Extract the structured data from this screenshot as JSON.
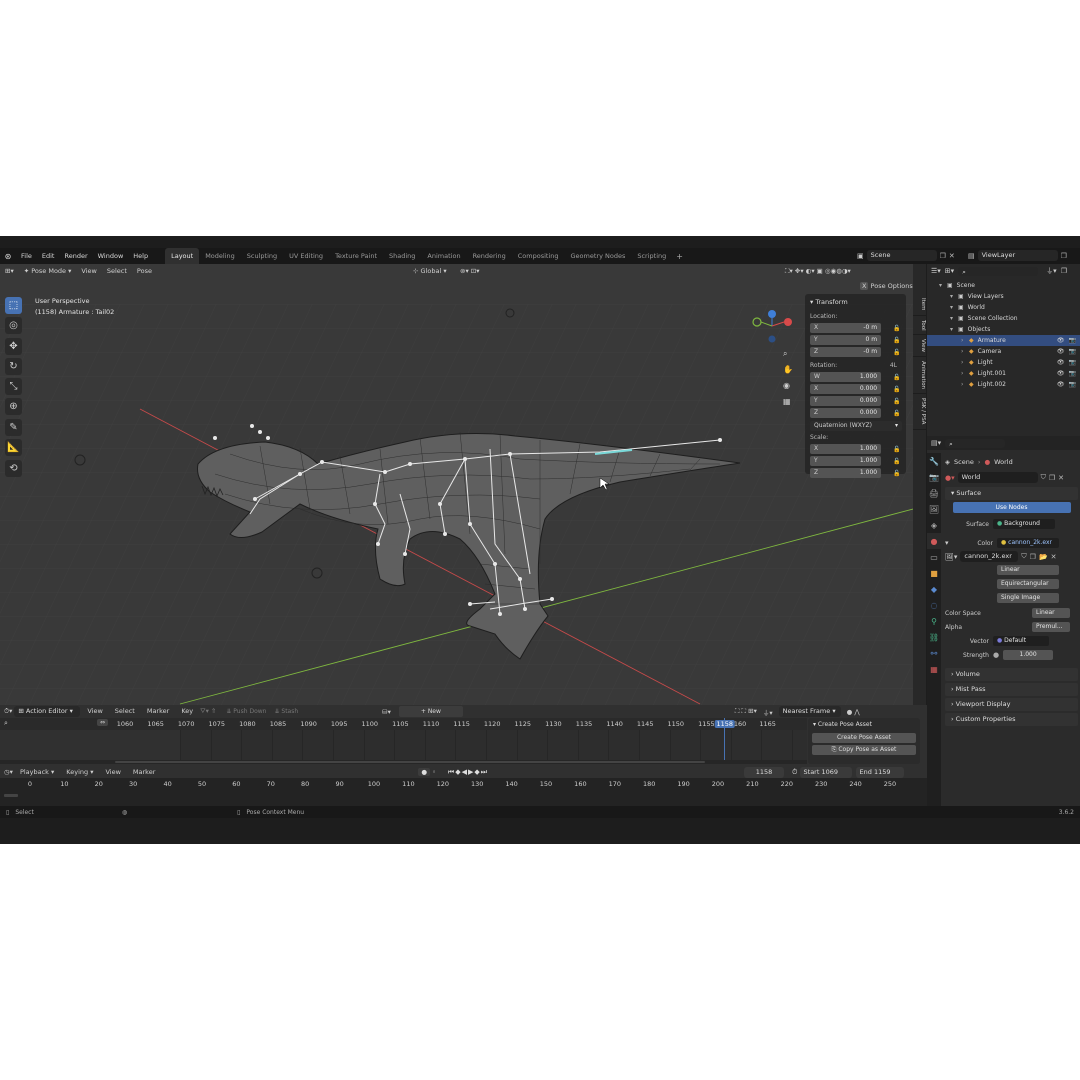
{
  "colors": {
    "accent": "#4772b3",
    "selected_row": "#334d80",
    "playhead": "#4772b3",
    "x_axis": "#c64a4a",
    "y_axis": "#7fb83f"
  },
  "menu": {
    "items": [
      "File",
      "Edit",
      "Render",
      "Window",
      "Help"
    ]
  },
  "workspaces": [
    "Layout",
    "Modeling",
    "Sculpting",
    "UV Editing",
    "Texture Paint",
    "Shading",
    "Animation",
    "Rendering",
    "Compositing",
    "Geometry Nodes",
    "Scripting"
  ],
  "active_workspace": "Layout",
  "scene_field": "Scene",
  "viewlayer_field": "ViewLayer",
  "viewport": {
    "mode": "Pose Mode",
    "header_menus": [
      "View",
      "Select",
      "Pose"
    ],
    "transform_orientation": "Global",
    "pose_options": "Pose Options",
    "overlay_title": "User Perspective",
    "overlay_subtitle": "(1158) Armature : Tail02"
  },
  "npanel": {
    "header": "Transform",
    "location_label": "Location:",
    "location": [
      {
        "axis": "X",
        "value": "-0 m"
      },
      {
        "axis": "Y",
        "value": "0 m"
      },
      {
        "axis": "Z",
        "value": "-0 m"
      }
    ],
    "rotation_label": "Rotation:",
    "rotation_mode_badge": "4L",
    "rotation": [
      {
        "axis": "W",
        "value": "1.000"
      },
      {
        "axis": "X",
        "value": "0.000"
      },
      {
        "axis": "Y",
        "value": "0.000"
      },
      {
        "axis": "Z",
        "value": "0.000"
      }
    ],
    "rotation_mode": "Quaternion (WXYZ)",
    "scale_label": "Scale:",
    "scale": [
      {
        "axis": "X",
        "value": "1.000"
      },
      {
        "axis": "Y",
        "value": "1.000"
      },
      {
        "axis": "Z",
        "value": "1.000"
      }
    ]
  },
  "side_tabs": [
    "Item",
    "Tool",
    "View",
    "Animation",
    "PSK / PSA"
  ],
  "outliner": {
    "rows": [
      {
        "label": "Scene",
        "indent": 0
      },
      {
        "label": "View Layers",
        "indent": 1
      },
      {
        "label": "World",
        "indent": 1
      },
      {
        "label": "Scene Collection",
        "indent": 1
      },
      {
        "label": "Objects",
        "indent": 1
      },
      {
        "label": "Armature",
        "indent": 2,
        "selected": true
      },
      {
        "label": "Camera",
        "indent": 2
      },
      {
        "label": "Light",
        "indent": 2
      },
      {
        "label": "Light.001",
        "indent": 2
      },
      {
        "label": "Light.002",
        "indent": 2
      }
    ]
  },
  "properties": {
    "breadcrumb_scene": "Scene",
    "breadcrumb_world": "World",
    "world_name": "World",
    "surface_header": "Surface",
    "use_nodes": "Use Nodes",
    "surface_label": "Surface",
    "surface_value": "Background",
    "color_label": "Color",
    "color_value": "cannon_2k.exr",
    "image_name": "cannon_2k.exr",
    "interpolation": "Linear",
    "projection": "Equirectangular",
    "source": "Single Image",
    "color_space_label": "Color Space",
    "color_space_value": "Linear",
    "alpha_label": "Alpha",
    "alpha_value": "Premul...",
    "vector_label": "Vector",
    "vector_value": "Default",
    "strength_label": "Strength",
    "strength_value": "1.000",
    "collapsed_panels": [
      "Volume",
      "Mist Pass",
      "Viewport Display",
      "Custom Properties"
    ]
  },
  "action_editor": {
    "editor_type": "Action Editor",
    "menus": [
      "View",
      "Select",
      "Marker",
      "Key"
    ],
    "push_down": "Push Down",
    "stash": "Stash",
    "new_button": "New",
    "snap_mode": "Nearest Frame",
    "frame_labels": [
      "1060",
      "1065",
      "1070",
      "1075",
      "1080",
      "1085",
      "1090",
      "1095",
      "1100",
      "1105",
      "1110",
      "1115",
      "1120",
      "1125",
      "1130",
      "1135",
      "1140",
      "1145",
      "1150",
      "1155",
      "1158",
      "160",
      "1165"
    ],
    "current_frame": "1158",
    "pose_asset_header": "Create Pose Asset",
    "create_pose_asset": "Create Pose Asset",
    "copy_pose_as_asset": "Copy Pose as Asset"
  },
  "timeline": {
    "menus": [
      "Playback",
      "Keying",
      "View",
      "Marker"
    ],
    "current_frame": "1158",
    "start_label": "Start",
    "start_value": "1069",
    "end_label": "End",
    "end_value": "1159",
    "ticks": [
      "0",
      "10",
      "20",
      "30",
      "40",
      "50",
      "60",
      "70",
      "80",
      "90",
      "100",
      "110",
      "120",
      "130",
      "140",
      "150",
      "160",
      "170",
      "180",
      "190",
      "200",
      "210",
      "220",
      "230",
      "240",
      "250"
    ]
  },
  "statusbar": {
    "select": "Select",
    "context": "Pose Context Menu",
    "version": "3.6.2"
  }
}
